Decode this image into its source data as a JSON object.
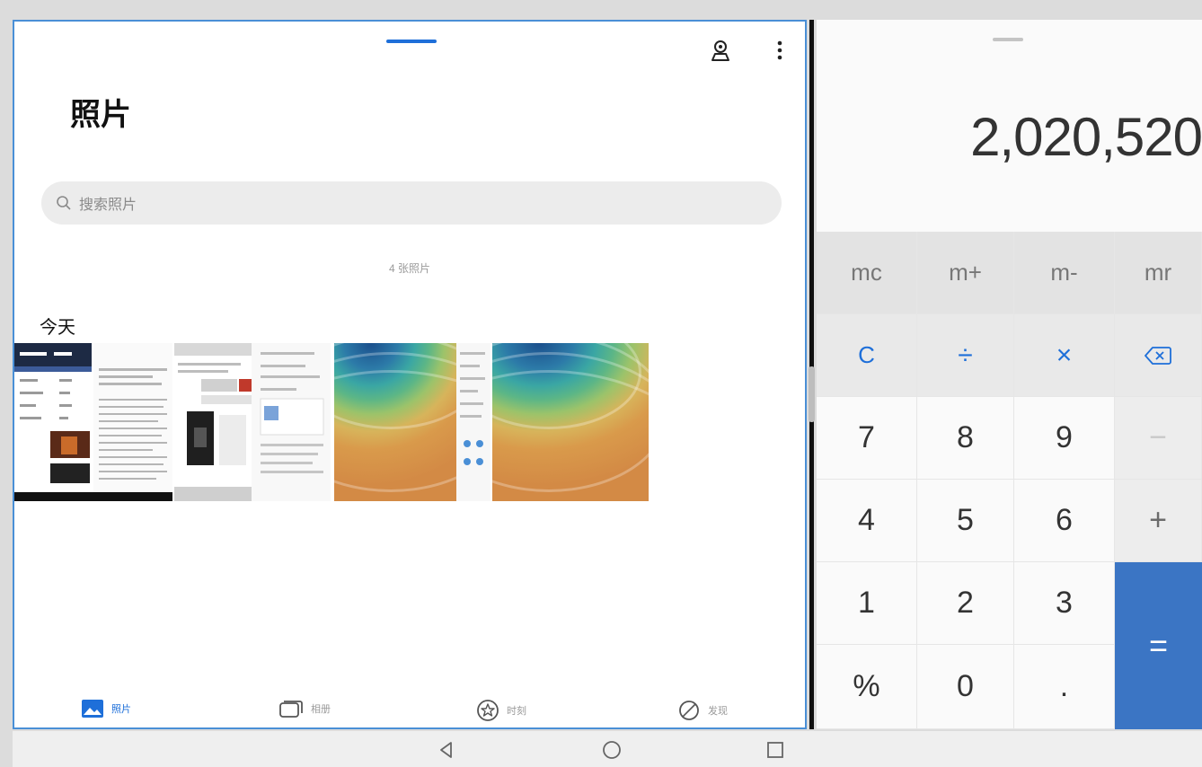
{
  "gallery": {
    "title": "照片",
    "search_placeholder": "搜索照片",
    "photo_count": "4 张照片",
    "section_label": "今天",
    "header_icons": [
      "map-pin-person-icon",
      "more-vert-icon"
    ],
    "tabs": [
      {
        "label": "照片",
        "icon": "photo-icon",
        "active": true
      },
      {
        "label": "相册",
        "icon": "album-icon",
        "active": false
      },
      {
        "label": "时刻",
        "icon": "moments-star-icon",
        "active": false
      },
      {
        "label": "发现",
        "icon": "discover-icon",
        "active": false
      }
    ],
    "thumbnails": [
      {
        "kind": "screenshot",
        "id": "thumb-1"
      },
      {
        "kind": "screenshot",
        "id": "thumb-2"
      },
      {
        "kind": "wallpaper",
        "id": "thumb-3"
      },
      {
        "kind": "wallpaper",
        "id": "thumb-4"
      }
    ]
  },
  "calculator": {
    "display": "2,020,520",
    "keys": {
      "mc": "mc",
      "mplus": "m+",
      "mminus": "m-",
      "mr": "mr",
      "clear": "C",
      "divide": "÷",
      "multiply": "×",
      "backspace": "⌫",
      "n7": "7",
      "n8": "8",
      "n9": "9",
      "minus": "−",
      "n4": "4",
      "n5": "5",
      "n6": "6",
      "plus": "+",
      "n1": "1",
      "n2": "2",
      "n3": "3",
      "equals": "=",
      "percent": "%",
      "n0": "0",
      "dot": "."
    }
  },
  "system_nav": {
    "back": "back-triangle-icon",
    "home": "home-circle-icon",
    "recents": "recents-square-icon"
  },
  "colors": {
    "accent": "#1e6fd9",
    "equals_key": "#3b75c4",
    "gallery_frame": "#4a8fd6"
  }
}
